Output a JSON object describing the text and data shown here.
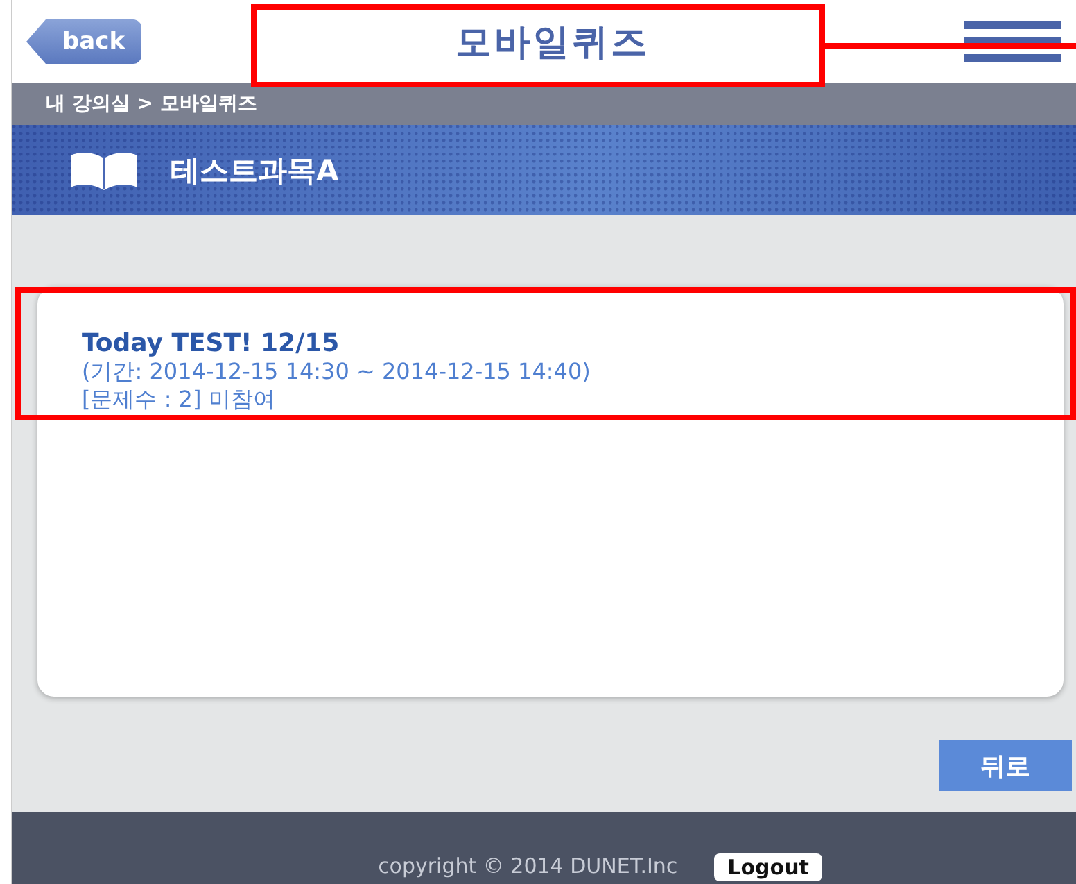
{
  "header": {
    "back_label": "back",
    "title": "모바일퀴즈"
  },
  "breadcrumb": "내 강의실 > 모바일퀴즈",
  "course": {
    "title": "테스트과목A"
  },
  "quiz": {
    "title": "Today TEST! 12/15",
    "period": "(기간: 2014-12-15 14:30 ~ 2014-12-15 14:40)",
    "status": "[문제수 : 2] 미참여"
  },
  "back_button": "뒤로",
  "footer": {
    "copyright": "copyright © 2014 DUNET.Inc",
    "logout": "Logout"
  }
}
